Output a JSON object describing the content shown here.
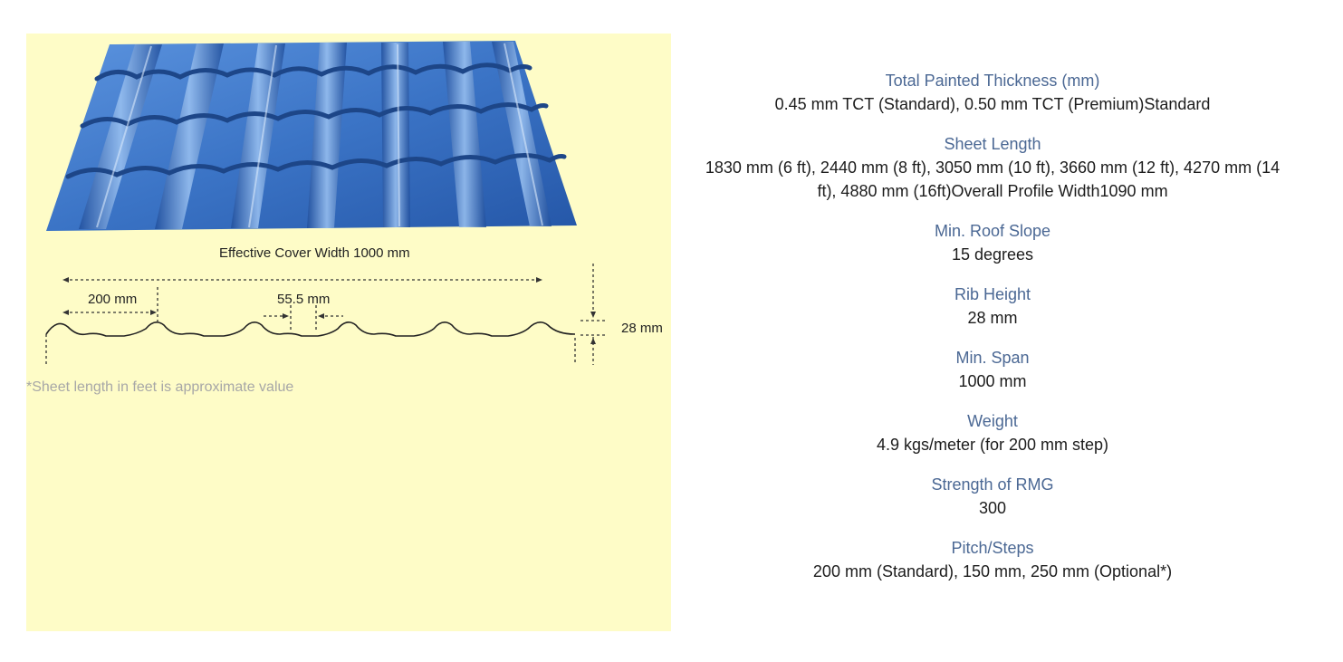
{
  "figure": {
    "cover_width_label": "Effective Cover Width 1000 mm",
    "pitch_label": "200 mm",
    "gap_label": "55.5 mm",
    "height_label": "28 mm",
    "sheet_color": "#3b74c6",
    "background_color": "#fefcc7"
  },
  "note": "*Sheet length in feet is approximate value",
  "specs": [
    {
      "label": "Total Painted Thickness (mm)",
      "value": "0.45 mm TCT (Standard), 0.50 mm TCT (Premium)Standard"
    },
    {
      "label": "Sheet Length",
      "value": "1830 mm (6 ft), 2440 mm (8 ft), 3050 mm (10 ft), 3660 mm (12 ft), 4270 mm (14 ft), 4880 mm (16ft)Overall Profile Width1090 mm"
    },
    {
      "label": "Min. Roof Slope",
      "value": "15 degrees"
    },
    {
      "label": "Rib Height",
      "value": "28 mm"
    },
    {
      "label": "Min. Span",
      "value": "1000 mm"
    },
    {
      "label": "Weight",
      "value": "4.9 kgs/meter (for 200 mm step)"
    },
    {
      "label": "Strength of RMG",
      "value": "300"
    },
    {
      "label": "Pitch/Steps",
      "value": "200 mm (Standard), 150 mm, 250 mm (Optional*)"
    }
  ]
}
